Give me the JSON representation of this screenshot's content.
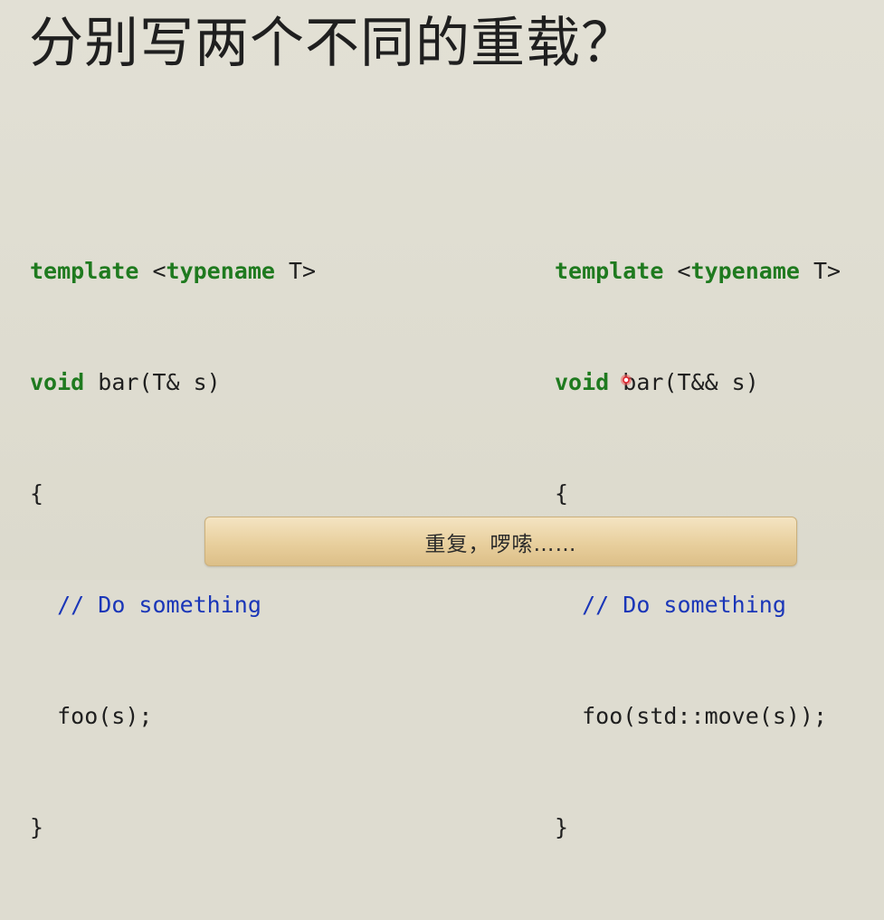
{
  "title": "分别写两个不同的重载？",
  "left_code": {
    "l1_kw1": "template",
    "l1_rest1": " <",
    "l1_kw2": "typename",
    "l1_rest2": " T>",
    "l2_kw": "void",
    "l2_rest": " bar(T& s)",
    "l3": "{",
    "l4_indent": "  ",
    "l4_comment": "// Do something",
    "l5": "  foo(s);",
    "l6": "}"
  },
  "right_code": {
    "l1_kw1": "template",
    "l1_rest1": " <",
    "l1_kw2": "typename",
    "l1_rest2": " T>",
    "l2_kw": "void",
    "l2_rest": " bar(T&& s)",
    "l3": "{",
    "l4_indent": "  ",
    "l4_comment": "// Do something",
    "l5": "  foo(std::move(s));",
    "l6": "}"
  },
  "bottom_note": "重复，啰嗦……",
  "colors": {
    "keyword": "#1f7a1f",
    "comment": "#1a36b8",
    "text": "#1f1f1f",
    "background": "#dedcd0",
    "note_bar": "#e8cf9d"
  }
}
